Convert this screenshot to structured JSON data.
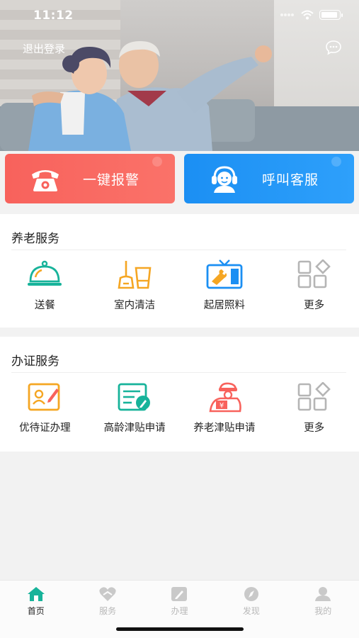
{
  "status_bar": {
    "time": "11:12"
  },
  "header": {
    "logout_label": "退出登录"
  },
  "actions": {
    "alarm_label": "一键报警",
    "service_label": "呼叫客服"
  },
  "elderly_services": {
    "title": "养老服务",
    "items": [
      {
        "label": "送餐",
        "icon": "food-cloche-icon"
      },
      {
        "label": "室内清洁",
        "icon": "cleaning-icon"
      },
      {
        "label": "起居照料",
        "icon": "tv-care-icon"
      },
      {
        "label": "更多",
        "icon": "more-grid-icon"
      }
    ]
  },
  "certificate_services": {
    "title": "办证服务",
    "items": [
      {
        "label": "优待证办理",
        "icon": "id-card-icon"
      },
      {
        "label": "高龄津贴申请",
        "icon": "form-edit-icon"
      },
      {
        "label": "养老津贴申请",
        "icon": "allowance-icon"
      },
      {
        "label": "更多",
        "icon": "more-grid-icon"
      }
    ]
  },
  "tabbar": {
    "tabs": [
      {
        "label": "首页",
        "icon": "home-icon",
        "active": true
      },
      {
        "label": "服务",
        "icon": "heart-hands-icon",
        "active": false
      },
      {
        "label": "办理",
        "icon": "edit-icon",
        "active": false
      },
      {
        "label": "发现",
        "icon": "compass-icon",
        "active": false
      },
      {
        "label": "我的",
        "icon": "user-icon",
        "active": false
      }
    ]
  },
  "colors": {
    "alarm": "#f8625c",
    "service": "#1b8ff3",
    "teal": "#17b39a",
    "orange": "#f5a623",
    "grey_icon": "#b5b5b5"
  }
}
